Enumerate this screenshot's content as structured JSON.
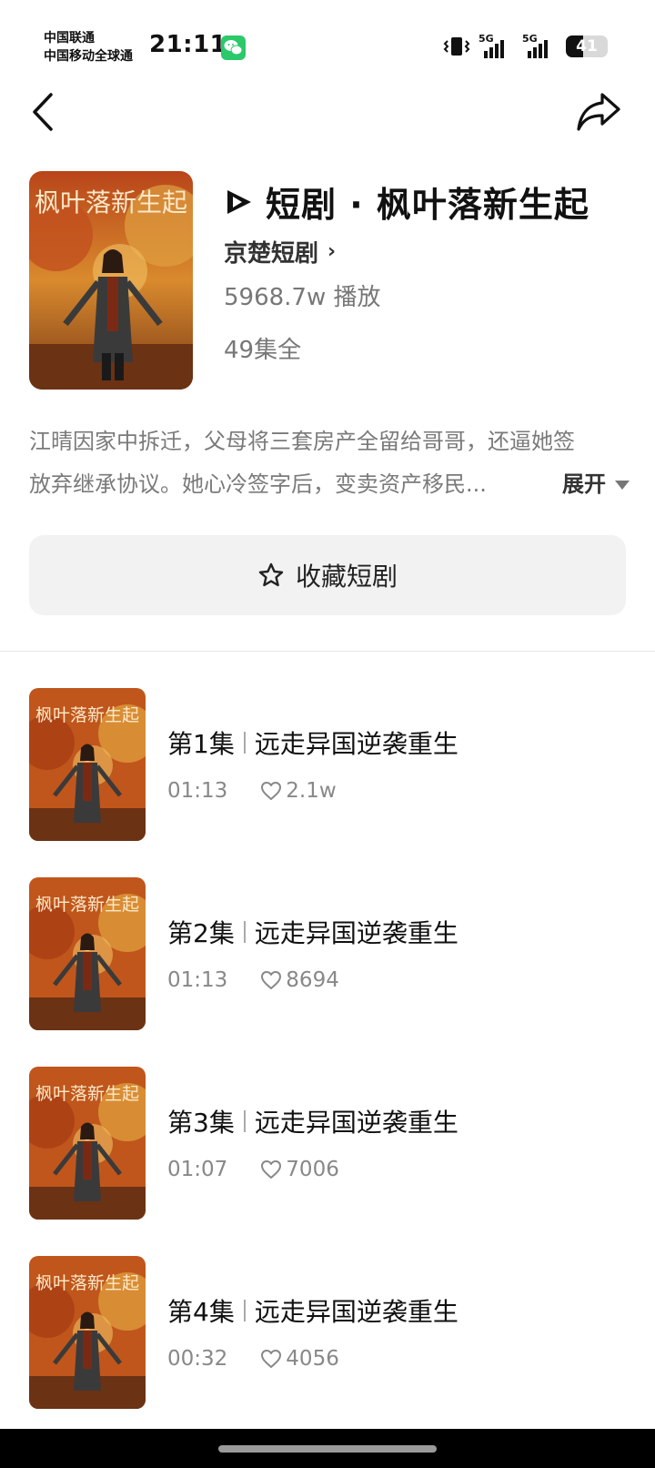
{
  "status_bar": {
    "carrier_1": "中国联通",
    "carrier_2": "中国移动全球通",
    "time": "21:11",
    "signal_1": "5G",
    "signal_2": "5G",
    "battery": "41",
    "battery_fraction": 0.41
  },
  "drama": {
    "logo_label": "短剧 · ",
    "title": "短剧 · 枫叶落新生起",
    "poster_title": "枫叶落新生起",
    "publisher": "京楚短剧",
    "plays": "5968.7w 播放",
    "episodes_total": "49集全",
    "description_line1": "江晴因家中拆迁，父母将三套房产全留给哥哥，还逼她签",
    "description_line2": "放弃继承协议。她心冷签字后，变卖资产移民...",
    "expand_label": "展开",
    "favorite_label": "收藏短剧"
  },
  "episodes": [
    {
      "number": "第1集",
      "name": "远走异国逆袭重生",
      "duration": "01:13",
      "likes": "2.1w"
    },
    {
      "number": "第2集",
      "name": "远走异国逆袭重生",
      "duration": "01:13",
      "likes": "8694"
    },
    {
      "number": "第3集",
      "name": "远走异国逆袭重生",
      "duration": "01:07",
      "likes": "7006"
    },
    {
      "number": "第4集",
      "name": "远走异国逆袭重生",
      "duration": "00:32",
      "likes": "4056"
    }
  ],
  "colors": {
    "accent": "#111111",
    "muted_text": "#7a7a7a",
    "wechat_green": "#2bc96a",
    "button_bg": "#f2f2f2"
  },
  "icons": {
    "back": "chevron-left-icon",
    "share": "share-arrow-icon",
    "favorite": "star-outline-icon",
    "likes": "heart-outline-icon",
    "logo": "play-logo-icon"
  }
}
